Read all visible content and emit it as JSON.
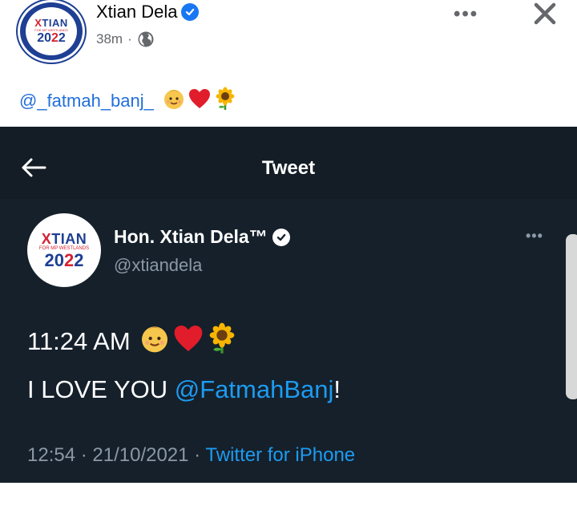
{
  "post": {
    "author": "Xtian Dela",
    "time": "38m",
    "dot": "·",
    "more_label": "•••",
    "caption_mention": "@_fatmah_banj_",
    "avatar": {
      "logo_x": "X",
      "logo_rest": "TIAN",
      "logo_sub": "FOR MP WESTLANDS",
      "logo_year_a": "20",
      "logo_year_b": "2",
      "logo_year_c": "2"
    }
  },
  "tweet": {
    "header_title": "Tweet",
    "display_name": "Hon. Xtian Dela™",
    "handle": "@xtiandela",
    "more_label": "•••",
    "line1_text": "11:24 AM",
    "line2_prefix": "I LOVE YOU ",
    "line2_mention": "@FatmahBanj",
    "line2_suffix": "!",
    "timestamp": "12:54 · 21/10/2021 · ",
    "source": "Twitter for iPhone"
  },
  "icons": {
    "verified": "verified-badge-icon",
    "globe": "globe-icon",
    "close": "close-icon",
    "back": "back-arrow-icon",
    "emoji": [
      "baby-face-emoji",
      "red-heart-emoji",
      "sunflower-emoji"
    ]
  },
  "colors": {
    "facebook_blue": "#1877f2",
    "link_blue": "#216fdb",
    "twitter_bg": "#15202b",
    "twitter_blue": "#1d9bf0",
    "muted": "#8b98a5"
  }
}
